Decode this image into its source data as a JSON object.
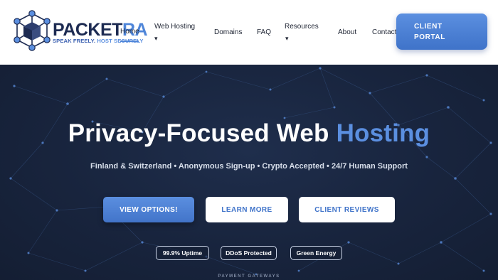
{
  "brand": {
    "name_part1": "PACKET",
    "name_part2": "RA",
    "tagline_part1": "SPEAK FREELY.",
    "tagline_part2": "HOST SECURELY",
    "colors": {
      "navy": "#1d2b52",
      "accent": "#4f86d9",
      "hero_bg": "#18243d"
    }
  },
  "nav": {
    "items": [
      {
        "label": "Home",
        "active": true
      },
      {
        "label": "Web Hosting",
        "has_dropdown": true
      },
      {
        "label": "Domains"
      },
      {
        "label": "FAQ"
      },
      {
        "label": "Resources",
        "has_dropdown": true
      },
      {
        "label": "About"
      },
      {
        "label": "Contact"
      }
    ],
    "dropdown_glyph": "▾",
    "client_portal_line1": "CLIENT",
    "client_portal_line2": "PORTAL"
  },
  "hero": {
    "title_main": "Privacy-Focused Web",
    "title_accent": "Hosting",
    "subtitle": "Finland & Switzerland • Anonymous Sign-up • Crypto Accepted • 24/7 Human Support",
    "buttons": {
      "view_options": "VIEW OPTIONS!",
      "learn_more": "LEARN MORE",
      "client_reviews": "CLIENT REVIEWS"
    },
    "badges": [
      "99.9% Uptime",
      "DDoS Protected",
      "Green Energy"
    ],
    "payment_label": "PAYMENT GATEWAYS"
  }
}
